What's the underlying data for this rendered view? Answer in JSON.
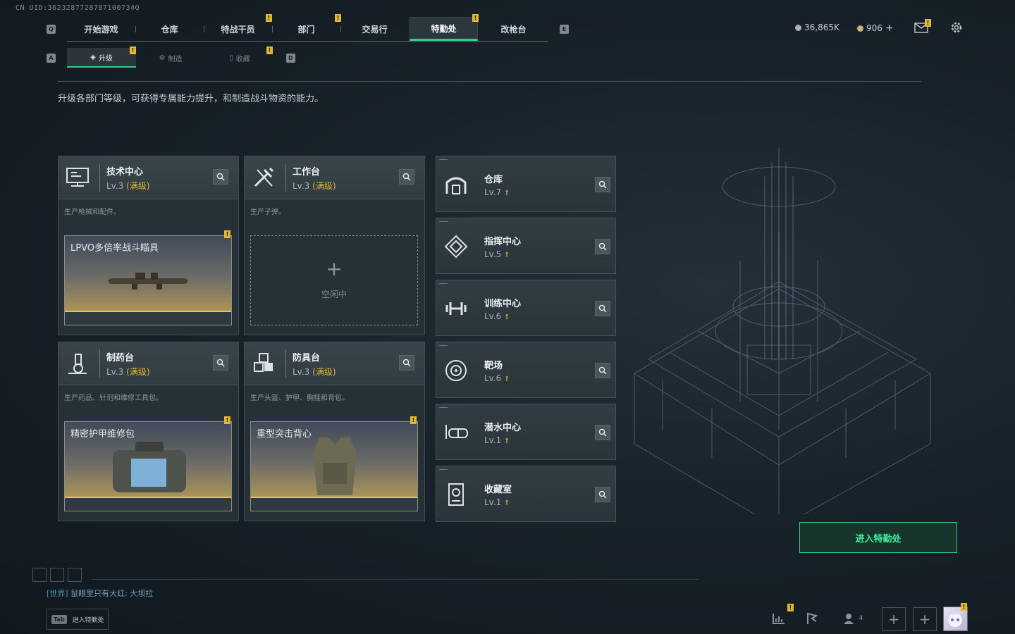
{
  "uid": "CN UID:3623287728787100734Q",
  "top_nav": {
    "q": "Q",
    "e": "E",
    "tabs": [
      "开始游戏",
      "仓库",
      "特战干员",
      "部门",
      "交易行",
      "特勤处",
      "改枪台"
    ],
    "active": "特勤处"
  },
  "currency": {
    "coins": "36,865K",
    "gems": "906"
  },
  "sub_nav": {
    "a": "A",
    "d": "D",
    "tabs": [
      "升级",
      "制造",
      "收藏"
    ],
    "active": "升级"
  },
  "description": "升级各部门等级，可获得专属能力提升，和制造战斗物资的能力。",
  "cards": [
    {
      "name": "技术中心",
      "level": "Lv.3",
      "max": "(满级)",
      "sub": "生产枪械和配件。",
      "slot": "LPVO多倍率战斗瞄具"
    },
    {
      "name": "工作台",
      "level": "Lv.3",
      "max": "(满级)",
      "sub": "生产子弹。",
      "slot": "",
      "idle": "空闲中"
    },
    {
      "name": "制药台",
      "level": "Lv.3",
      "max": "(满级)",
      "sub": "生产药品、针剂和维修工具包。",
      "slot": "精密护甲维修包"
    },
    {
      "name": "防具台",
      "level": "Lv.3",
      "max": "(满级)",
      "sub": "生产头盔、护甲、胸挂和背包。",
      "slot": "重型突击背心"
    }
  ],
  "rooms": [
    {
      "name": "仓库",
      "level": "Lv.7"
    },
    {
      "name": "指挥中心",
      "level": "Lv.5"
    },
    {
      "name": "训练中心",
      "level": "Lv.6"
    },
    {
      "name": "靶场",
      "level": "Lv.6"
    },
    {
      "name": "潜水中心",
      "level": "Lv.1"
    },
    {
      "name": "收藏室",
      "level": "Lv.1"
    }
  ],
  "enter_button": "进入特勤处",
  "chat": {
    "channel": "[世界]",
    "message": "鼠眼里只有大红: 大坝拉"
  },
  "tab_hint": {
    "key": "Tab",
    "label": "进入特勤处"
  },
  "friends_count": "4",
  "colors": {
    "accent": "#2fcf88",
    "gold": "#e2b632"
  }
}
